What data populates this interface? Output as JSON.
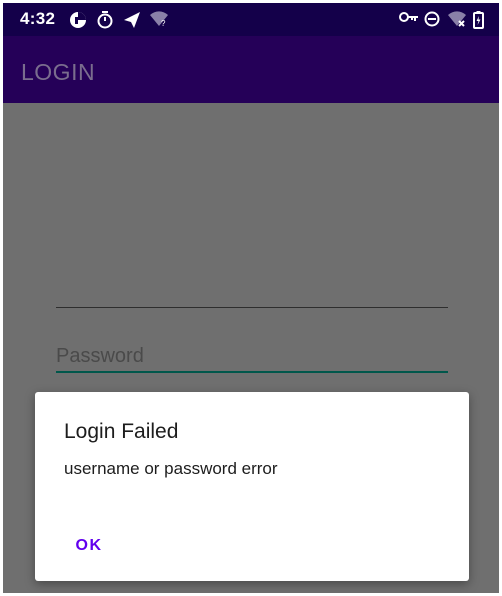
{
  "status_bar": {
    "time": "4:32",
    "left_icons": [
      "app-notification-icon",
      "timer-icon",
      "send-icon",
      "wifi-question-icon"
    ],
    "right_icons": [
      "vpn-key-icon",
      "do-not-disturb-icon",
      "wifi-off-icon",
      "battery-icon"
    ]
  },
  "app_bar": {
    "title": "LOGIN"
  },
  "login_form": {
    "username_value": "",
    "password_placeholder": "Password"
  },
  "dialog": {
    "title": "Login Failed",
    "message": "username or password error",
    "ok_label": "OK"
  },
  "colors": {
    "status_bar": "#14004a",
    "app_bar": "#250058",
    "scrim": "#6f6f6f",
    "accent": "#6200ee",
    "input_underline_focused": "#00574b"
  }
}
